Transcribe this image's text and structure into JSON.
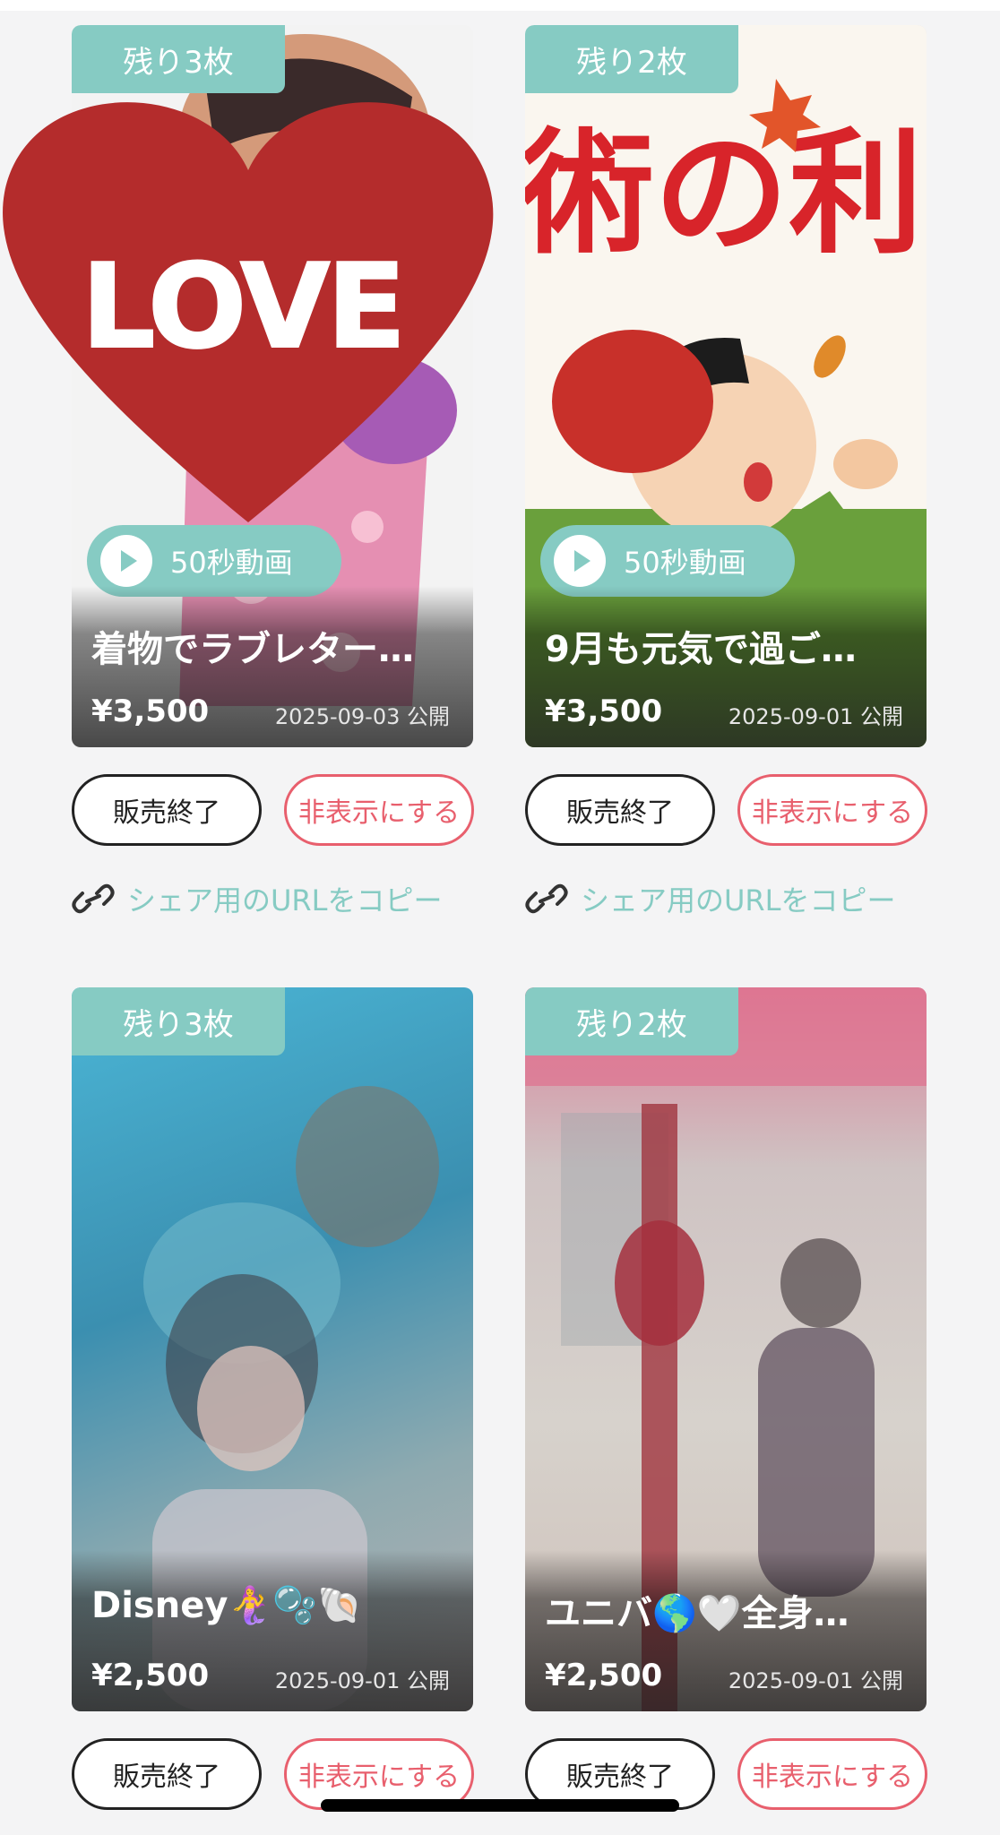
{
  "cards": [
    {
      "stock": "残り3枚",
      "video_label": "50秒動画",
      "title": "着物でラブレター…",
      "price": "¥3,500",
      "date": "2025-09-03 公開",
      "end_label": "販売終了",
      "hide_label": "非表示にする",
      "share_label": "シェア用のURLをコピー",
      "sticker_text": "LOVE"
    },
    {
      "stock": "残り2枚",
      "video_label": "50秒動画",
      "title": "9月も元気で過ご…",
      "price": "¥3,500",
      "date": "2025-09-01 公開",
      "end_label": "販売終了",
      "hide_label": "非表示にする",
      "share_label": "シェア用のURLをコピー",
      "image_text": "術の利"
    },
    {
      "stock": "残り3枚",
      "title": "Disney🧜‍♀️🫧🐚",
      "price": "¥2,500",
      "date": "2025-09-01 公開",
      "end_label": "販売終了",
      "hide_label": "非表示にする"
    },
    {
      "stock": "残り2枚",
      "title": "ユニバ🌎🤍全身…",
      "price": "¥2,500",
      "date": "2025-09-01 公開",
      "end_label": "販売終了",
      "hide_label": "非表示にする"
    }
  ],
  "colors": {
    "accent": "#86cbc3",
    "danger": "#e85f6d",
    "background": "#f4f4f5"
  }
}
